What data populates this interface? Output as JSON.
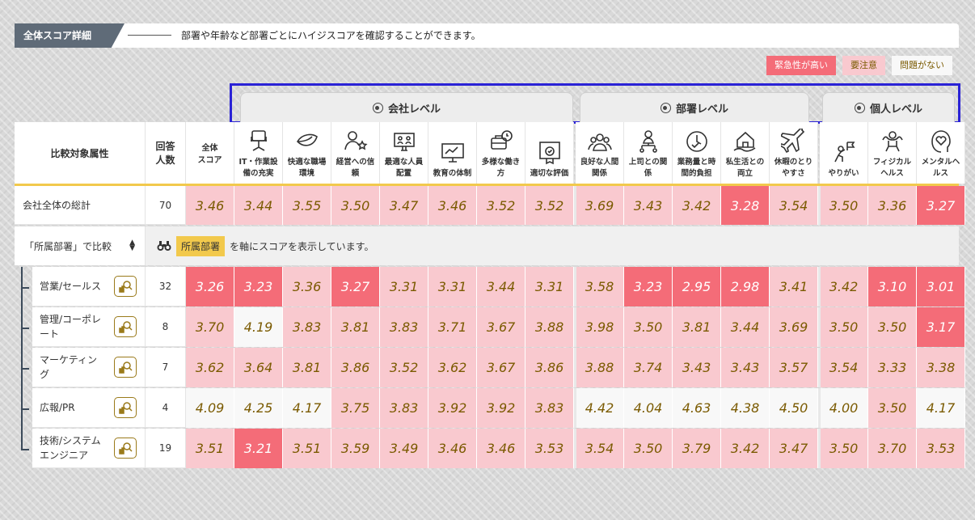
{
  "header": {
    "tag": "全体スコア詳細",
    "description": "部署や年齢など部署ごとにハイジスコアを確認することができます。"
  },
  "legend": {
    "urgent": "緊急性が高い",
    "caution": "要注意",
    "ok": "問題がない"
  },
  "colors": {
    "urgent": "#f46c78",
    "caution": "#f9c9cf",
    "ok": "#f8f8f8",
    "highlight": "#f2c94c",
    "tab_outline": "#2a22d6"
  },
  "levels": {
    "company": "会社レベル",
    "department": "部署レベル",
    "individual": "個人レベル"
  },
  "columns": {
    "attribute": "比較対象属性",
    "respondents": "回答\n人数",
    "overall": "全体\nスコア",
    "metrics": [
      {
        "label": "IT・作業設\n備の充実",
        "icon": "office-chair-icon"
      },
      {
        "label": "快適な職場\n環境",
        "icon": "leaf-icon"
      },
      {
        "label": "経営への信\n頼",
        "icon": "person-star-icon"
      },
      {
        "label": "最適な人員\n配置",
        "icon": "team-arrange-icon"
      },
      {
        "label": "教育の体制",
        "icon": "whiteboard-icon"
      },
      {
        "label": "多様な働き\n方",
        "icon": "briefcase-clock-icon"
      },
      {
        "label": "適切な評価",
        "icon": "certificate-icon"
      },
      {
        "label": "良好な人間\n関係",
        "icon": "people-group-icon"
      },
      {
        "label": "上司との関\n係",
        "icon": "boss-hierarchy-icon"
      },
      {
        "label": "業務量と時\n間的負担",
        "icon": "clock-check-icon"
      },
      {
        "label": "私生活との\n両立",
        "icon": "house-hand-icon"
      },
      {
        "label": "休暇のとり\nやすさ",
        "icon": "airplane-icon"
      },
      {
        "label": "やりがい",
        "icon": "flag-person-icon"
      },
      {
        "label": "フィジカル\nヘルス",
        "icon": "strong-person-icon"
      },
      {
        "label": "メンタルヘ\nルス",
        "icon": "heart-head-icon"
      }
    ]
  },
  "company_total": {
    "name": "会社全体の総計",
    "count": "70",
    "overall": {
      "v": "3.46",
      "s": "c"
    },
    "scores": [
      {
        "v": "3.44",
        "s": "c"
      },
      {
        "v": "3.55",
        "s": "c"
      },
      {
        "v": "3.50",
        "s": "c"
      },
      {
        "v": "3.47",
        "s": "c"
      },
      {
        "v": "3.46",
        "s": "c"
      },
      {
        "v": "3.52",
        "s": "c"
      },
      {
        "v": "3.52",
        "s": "c"
      },
      {
        "v": "3.69",
        "s": "c"
      },
      {
        "v": "3.43",
        "s": "c"
      },
      {
        "v": "3.42",
        "s": "c"
      },
      {
        "v": "3.28",
        "s": "u"
      },
      {
        "v": "3.54",
        "s": "c"
      },
      {
        "v": "3.50",
        "s": "c"
      },
      {
        "v": "3.36",
        "s": "c"
      },
      {
        "v": "3.27",
        "s": "u"
      }
    ]
  },
  "filter": {
    "select_label": "「所属部署」で比較",
    "badge": "所属部署",
    "message": "を軸にスコアを表示しています。"
  },
  "departments": [
    {
      "name": "営業/セールス",
      "count": "32",
      "overall": {
        "v": "3.26",
        "s": "u"
      },
      "scores": [
        {
          "v": "3.23",
          "s": "u"
        },
        {
          "v": "3.36",
          "s": "c"
        },
        {
          "v": "3.27",
          "s": "u"
        },
        {
          "v": "3.31",
          "s": "c"
        },
        {
          "v": "3.31",
          "s": "c"
        },
        {
          "v": "3.44",
          "s": "c"
        },
        {
          "v": "3.31",
          "s": "c"
        },
        {
          "v": "3.58",
          "s": "c"
        },
        {
          "v": "3.23",
          "s": "u"
        },
        {
          "v": "2.95",
          "s": "u"
        },
        {
          "v": "2.98",
          "s": "u"
        },
        {
          "v": "3.41",
          "s": "c"
        },
        {
          "v": "3.42",
          "s": "c"
        },
        {
          "v": "3.10",
          "s": "u"
        },
        {
          "v": "3.01",
          "s": "u"
        }
      ]
    },
    {
      "name": "管理/コーポレ\nート",
      "count": "8",
      "overall": {
        "v": "3.70",
        "s": "c"
      },
      "scores": [
        {
          "v": "4.19",
          "s": "o"
        },
        {
          "v": "3.83",
          "s": "c"
        },
        {
          "v": "3.81",
          "s": "c"
        },
        {
          "v": "3.83",
          "s": "c"
        },
        {
          "v": "3.71",
          "s": "c"
        },
        {
          "v": "3.67",
          "s": "c"
        },
        {
          "v": "3.88",
          "s": "c"
        },
        {
          "v": "3.98",
          "s": "c"
        },
        {
          "v": "3.50",
          "s": "c"
        },
        {
          "v": "3.81",
          "s": "c"
        },
        {
          "v": "3.44",
          "s": "c"
        },
        {
          "v": "3.69",
          "s": "c"
        },
        {
          "v": "3.50",
          "s": "c"
        },
        {
          "v": "3.50",
          "s": "c"
        },
        {
          "v": "3.17",
          "s": "u"
        }
      ]
    },
    {
      "name": "マーケティン\nグ",
      "count": "7",
      "overall": {
        "v": "3.62",
        "s": "c"
      },
      "scores": [
        {
          "v": "3.64",
          "s": "c"
        },
        {
          "v": "3.81",
          "s": "c"
        },
        {
          "v": "3.86",
          "s": "c"
        },
        {
          "v": "3.52",
          "s": "c"
        },
        {
          "v": "3.62",
          "s": "c"
        },
        {
          "v": "3.67",
          "s": "c"
        },
        {
          "v": "3.86",
          "s": "c"
        },
        {
          "v": "3.88",
          "s": "c"
        },
        {
          "v": "3.74",
          "s": "c"
        },
        {
          "v": "3.43",
          "s": "c"
        },
        {
          "v": "3.43",
          "s": "c"
        },
        {
          "v": "3.57",
          "s": "c"
        },
        {
          "v": "3.54",
          "s": "c"
        },
        {
          "v": "3.33",
          "s": "c"
        },
        {
          "v": "3.38",
          "s": "c"
        }
      ]
    },
    {
      "name": "広報/PR",
      "count": "4",
      "overall": {
        "v": "4.09",
        "s": "o"
      },
      "scores": [
        {
          "v": "4.25",
          "s": "o"
        },
        {
          "v": "4.17",
          "s": "o"
        },
        {
          "v": "3.75",
          "s": "c"
        },
        {
          "v": "3.83",
          "s": "c"
        },
        {
          "v": "3.92",
          "s": "c"
        },
        {
          "v": "3.92",
          "s": "c"
        },
        {
          "v": "3.83",
          "s": "c"
        },
        {
          "v": "4.42",
          "s": "o"
        },
        {
          "v": "4.04",
          "s": "o"
        },
        {
          "v": "4.63",
          "s": "o"
        },
        {
          "v": "4.38",
          "s": "o"
        },
        {
          "v": "4.50",
          "s": "o"
        },
        {
          "v": "4.00",
          "s": "o"
        },
        {
          "v": "3.50",
          "s": "c"
        },
        {
          "v": "4.17",
          "s": "o"
        }
      ]
    },
    {
      "name": "技術/システム\nエンジニア",
      "count": "19",
      "overall": {
        "v": "3.51",
        "s": "c"
      },
      "scores": [
        {
          "v": "3.21",
          "s": "u"
        },
        {
          "v": "3.51",
          "s": "c"
        },
        {
          "v": "3.59",
          "s": "c"
        },
        {
          "v": "3.49",
          "s": "c"
        },
        {
          "v": "3.46",
          "s": "c"
        },
        {
          "v": "3.46",
          "s": "c"
        },
        {
          "v": "3.53",
          "s": "c"
        },
        {
          "v": "3.54",
          "s": "c"
        },
        {
          "v": "3.50",
          "s": "c"
        },
        {
          "v": "3.79",
          "s": "c"
        },
        {
          "v": "3.42",
          "s": "c"
        },
        {
          "v": "3.47",
          "s": "c"
        },
        {
          "v": "3.50",
          "s": "c"
        },
        {
          "v": "3.70",
          "s": "c"
        },
        {
          "v": "3.53",
          "s": "c"
        }
      ]
    }
  ]
}
